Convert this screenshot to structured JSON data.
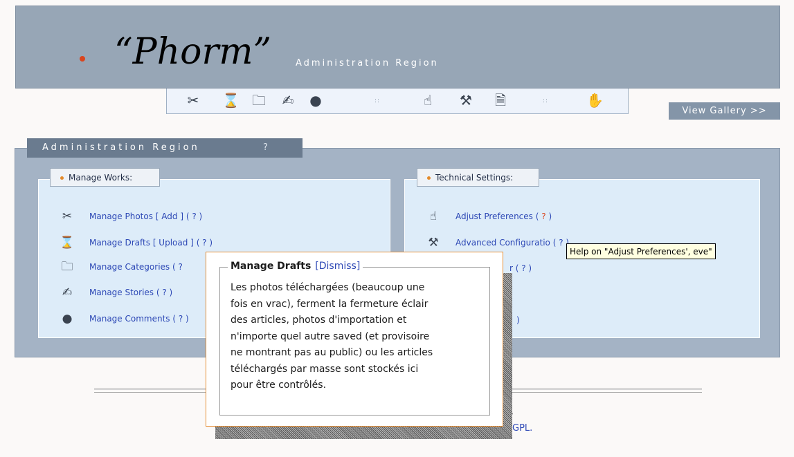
{
  "header": {
    "title": "“Phorm”",
    "subtitle": "Administration Region"
  },
  "toolbar": {
    "icons": [
      "scissors-icon",
      "hourglass-icon",
      "folder-icon",
      "pen-icon",
      "comments-icon",
      "hand-preferences-icon",
      "tools-icon",
      "document-icon",
      "hand-icon"
    ],
    "separator": "::"
  },
  "view_gallery": "View Gallery >>",
  "admin_region": {
    "title": "Administration Region",
    "help": "?"
  },
  "manage_works": {
    "label": "Manage Works:",
    "items": [
      {
        "label": "Manage Photos",
        "sub": "[ Add ]",
        "help": "( ? )"
      },
      {
        "label": "Manage Drafts",
        "sub": "[ Upload ]",
        "help": "( ? )"
      },
      {
        "label": "Manage Categories",
        "help": "( ?"
      },
      {
        "label": "Manage Stories",
        "help": "( ? )"
      },
      {
        "label": "Manage Comments",
        "help": "( ? )"
      }
    ]
  },
  "technical_settings": {
    "label": "Technical Settings:",
    "items": [
      {
        "label": "Adjust Preferences",
        "help_open": "(",
        "help_q": "?",
        "help_close": ")"
      },
      {
        "label": "Advanced Configuratio",
        "help": "( ? )"
      },
      {
        "help": "r ( ? )"
      },
      {
        "help": ")"
      }
    ]
  },
  "popup": {
    "title": "Manage Drafts",
    "dismiss": "[Dismiss]",
    "lines": [
      "Les photos téléchargées (beaucoup une",
      "fois en vrac), ferment la fermeture éclair",
      "des articles, photos d'importation et",
      "n'importe quel autre saved (et provisoire",
      "ne montrant pas au public) ou les articles",
      "téléchargés par masse sont stockés ici",
      "pour être contrôlés."
    ]
  },
  "tooltip": "Help on \"Adjust Preferences', eve\"",
  "footer": {
    "comma": ",",
    "gpl": "GPL."
  },
  "colors": {
    "header_bg": "#97a6b6",
    "panel_bg": "#a4b3c5",
    "section_bg": "#ddecf9",
    "accent": "#d9451e",
    "link": "#2c47b5",
    "popup_border": "#e58d33"
  }
}
